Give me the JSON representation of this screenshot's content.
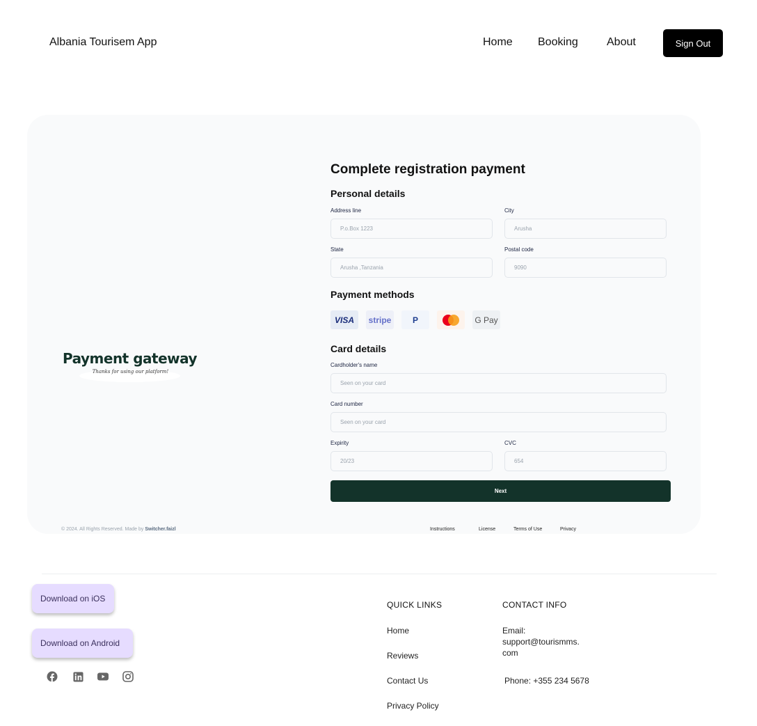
{
  "header": {
    "brand": "Albania Tourisem App",
    "nav": [
      "Home",
      "Booking",
      "About"
    ],
    "sign_out": "Sign Out"
  },
  "hero": {
    "title": "Payment gateway",
    "subtitle": "Thanks for using our platform!"
  },
  "form": {
    "title": "Complete registration payment",
    "personal_title": "Personal details",
    "address": {
      "label": "Address line",
      "placeholder": "P.o.Box 1223"
    },
    "city": {
      "label": "City",
      "placeholder": "Arusha"
    },
    "state": {
      "label": "State",
      "placeholder": "Arusha ,Tanzania"
    },
    "postal": {
      "label": "Postal code",
      "placeholder": "9090"
    },
    "payment_title": "Payment methods",
    "payment_methods": [
      "VISA",
      "stripe",
      "P",
      "mastercard",
      "G Pay"
    ],
    "card_title": "Card details",
    "holder": {
      "label": "Cardholder's name",
      "placeholder": "Seen on your card"
    },
    "number": {
      "label": "Card number",
      "placeholder": "Seen on your card"
    },
    "expiry": {
      "label": "Expirity",
      "placeholder": "20/23"
    },
    "cvc": {
      "label": "CVC",
      "placeholder": "654"
    },
    "next": "Next"
  },
  "card_footer": {
    "copyright_prefix": "© 2024. All Rights Reserved. Made by ",
    "author": "Switcher.faizl",
    "links": [
      "Instructions",
      "License",
      "Terms of Use",
      "Privacy"
    ]
  },
  "footer": {
    "download_ios": "Download on iOS",
    "download_android": "Download on  Android",
    "social": [
      "facebook-icon",
      "linkedin-icon",
      "youtube-icon",
      "instagram-icon"
    ],
    "quick_links_title": "QUICK LINKS",
    "quick_links": [
      "Home",
      "Reviews",
      "Contact Us",
      "Privacy Policy"
    ],
    "contact_title": "CONTACT INFO",
    "email_line1": "Email:",
    "email_line2": "support@tourismms.",
    "email_line3": "com",
    "phone": "Phone: +355 234 5678"
  },
  "colors": {
    "primary": "#13332a",
    "download_bg": "#e6dcff",
    "card_bg": "#f9fafb"
  }
}
